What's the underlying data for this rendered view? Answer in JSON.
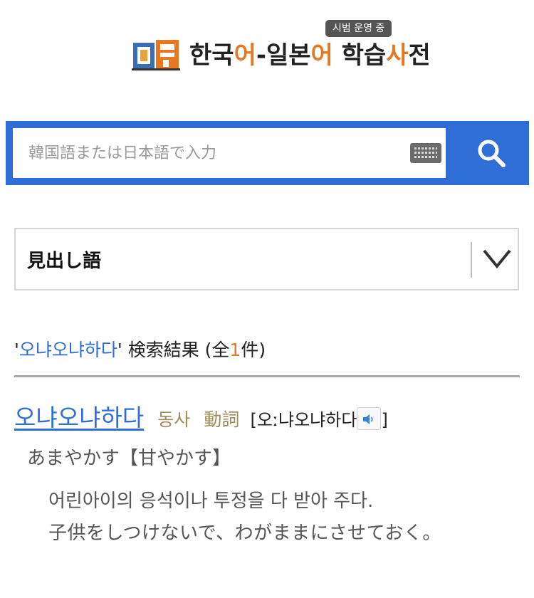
{
  "header": {
    "title_part1": "한국",
    "title_part2": "어",
    "title_part3": "-일본",
    "title_part4": "어",
    "title_part5": " 학습",
    "title_part6": "사",
    "title_part7": "전",
    "beta_badge": "시범 운영 중"
  },
  "search": {
    "placeholder": "韓国語または日本語で入力",
    "value": "",
    "keyboard_icon": "keyboard-icon",
    "button_icon": "search-icon"
  },
  "filter": {
    "selected": "見出し語",
    "chevron_icon": "chevron-down-icon"
  },
  "results": {
    "quote_open": "'",
    "keyword": "오냐오냐하다",
    "quote_close": "'",
    "label": " 検索結果 (全",
    "count": "1",
    "suffix": "件)"
  },
  "entry": {
    "word": "오냐오냐하다",
    "pos_ko": "동사",
    "pos_ja": "動詞",
    "pronunciation_open": "[",
    "pronunciation": "오ː냐오냐하다",
    "pronunciation_close": "]",
    "sound_icon": "speaker-icon",
    "sense": "あまやかす【甘やかす】",
    "definition_ko": "어린아이의 응석이나 투정을 다 받아 주다.",
    "definition_ja": "子供をしつけないで、わがままにさせておく。"
  },
  "colors": {
    "accent_blue": "#2f6ed6",
    "accent_orange": "#e87722",
    "pos_gold": "#a08a55"
  }
}
